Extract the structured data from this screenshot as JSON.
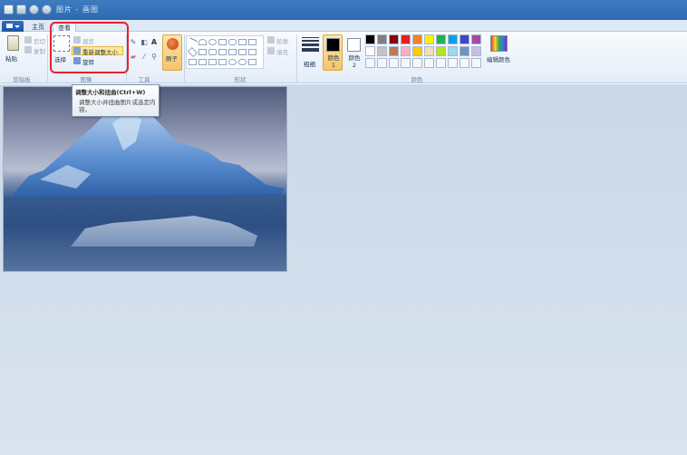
{
  "titlebar": {
    "title": "图片 - 画图"
  },
  "tabs": {
    "home": "主页",
    "view": "查看"
  },
  "clipboard": {
    "paste": "粘贴",
    "cut": "剪切",
    "copy": "复制",
    "label": "剪贴板"
  },
  "image_group": {
    "select": "选择",
    "crop": "裁剪",
    "resize": "重新调整大小",
    "rotate": "旋转",
    "label": "图像"
  },
  "tools_group": {
    "label": "工具"
  },
  "brushes": {
    "label": "刷子"
  },
  "shapes_group": {
    "outline": "轮廓",
    "fill": "填充",
    "label": "形状"
  },
  "size": {
    "label": "粗细"
  },
  "colors": {
    "color1": "颜色 1",
    "color2": "颜色 2",
    "edit": "编辑颜色",
    "label": "颜色",
    "color1_value": "#000000",
    "color2_value": "#ffffff",
    "palette_row1": [
      "#000000",
      "#7f7f7f",
      "#880015",
      "#ed1c24",
      "#ff7f27",
      "#fff200",
      "#22b14c",
      "#00a2e8",
      "#3f48cc",
      "#a349a4"
    ],
    "palette_row2": [
      "#ffffff",
      "#c3c3c3",
      "#b97a57",
      "#ffaec9",
      "#ffc90e",
      "#efe4b0",
      "#b5e61d",
      "#99d9ea",
      "#7092be",
      "#c8bfe7"
    ]
  },
  "tooltip": {
    "title": "调整大小和扭曲(Ctrl+W)",
    "body": "调整大小并扭曲图片或选定内容。"
  }
}
